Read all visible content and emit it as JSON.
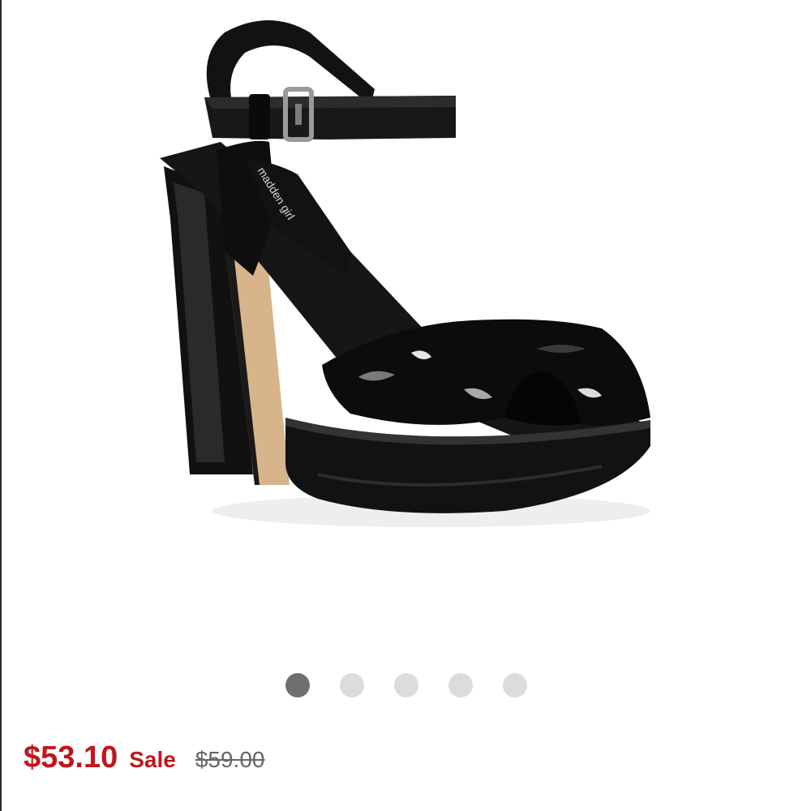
{
  "product": {
    "brand_text": "madden girl",
    "image_icon": "platform-sandal-image"
  },
  "carousel": {
    "total": 5,
    "active_index": 0,
    "active_color": "#6f6f6f",
    "inactive_color": "#dcdcdc"
  },
  "price": {
    "current": "$53.10",
    "sale_label": "Sale",
    "original": "$59.00",
    "sale_color": "#c0161c",
    "original_color": "#666666"
  }
}
